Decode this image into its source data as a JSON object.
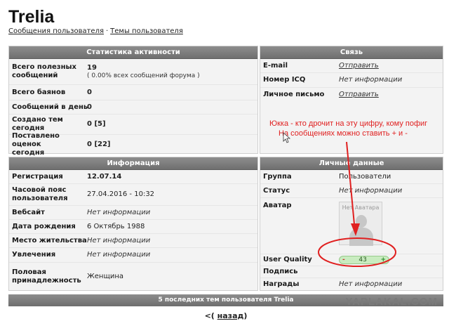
{
  "page": {
    "title": "Trelia"
  },
  "breadcrumb": {
    "link1": "Сообщения пользователя",
    "sep": "·",
    "link2": "Темы пользователя"
  },
  "activity": {
    "header": "Статистика активности",
    "rows": [
      {
        "label": "Всего полезных сообщений",
        "value": "19",
        "sub": "( 0.00% всех сообщений форума )"
      },
      {
        "label": "Всего баянов",
        "value": "0"
      },
      {
        "label": "Сообщений в день",
        "value": "0"
      },
      {
        "label": "Создано тем сегодня",
        "value": "0 [5]"
      },
      {
        "label": "Поставлено оценок сегодня",
        "value": "0 [22]"
      }
    ]
  },
  "contact": {
    "header": "Связь",
    "rows": [
      {
        "label": "E-mail",
        "value": "Отправить"
      },
      {
        "label": "Номер ICQ",
        "value": "Нет информации"
      },
      {
        "label": "Личное письмо",
        "value": "Отправить"
      }
    ]
  },
  "info": {
    "header": "Информация",
    "rows": [
      {
        "label": "Регистрация",
        "value": "12.07.14"
      },
      {
        "label": "Часовой пояс пользователя",
        "value": "27.04.2016 - 10:32"
      },
      {
        "label": "Вебсайт",
        "value": "Нет информации"
      },
      {
        "label": "Дата рождения",
        "value": "6 Октябрь 1988"
      },
      {
        "label": "Место жительства",
        "value": "Нет информации"
      },
      {
        "label": "Увлечения",
        "value": "Нет информации"
      },
      {
        "label": "Половая принадлежность",
        "value": "Женщина"
      }
    ]
  },
  "personal": {
    "header": "Личные данные",
    "rows": [
      {
        "label": "Группа",
        "value": "Пользователи"
      },
      {
        "label": "Статус",
        "value": "Нет информации"
      },
      {
        "label": "Аватар",
        "value": "Нет Аватара"
      },
      {
        "label": "User Quality",
        "minus": "-",
        "value": "43",
        "plus": "+"
      },
      {
        "label": "Подпись",
        "value": ""
      },
      {
        "label": "Награды",
        "value": "Нет информации"
      }
    ]
  },
  "topics_bar": {
    "label": "5 последних тем пользователя Trelia"
  },
  "pager": {
    "prev": "<(",
    "link": "назад",
    "close": ")"
  },
  "annotation": {
    "line1": "Юкка - кто дрочит на эту цифру, кому пофиг",
    "line2": "На сообщениях можно ставить + и -",
    "color": "#e02020"
  },
  "watermark": "YAPLAKAL.COM"
}
